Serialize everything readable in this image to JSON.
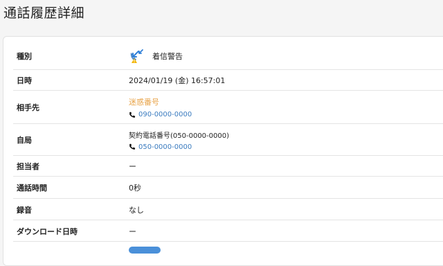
{
  "page": {
    "title": "通話履歴詳細"
  },
  "details": {
    "type_label": "種別",
    "type_value": "着信警告",
    "datetime_label": "日時",
    "datetime_value": "2024/01/19 (金) 16:57:01",
    "partner_label": "相手先",
    "partner_name": "迷惑番号",
    "partner_phone": "090-0000-0000",
    "own_label": "自局",
    "own_name": "契約電話番号(050-0000-0000)",
    "own_phone": "050-0000-0000",
    "staff_label": "担当者",
    "staff_value": "ー",
    "duration_label": "通話時間",
    "duration_value": "0秒",
    "recording_label": "録音",
    "recording_value": "なし",
    "download_label": "ダウンロード日時",
    "download_value": "ー"
  },
  "colors": {
    "accent_orange": "#e8a44a",
    "link_blue": "#3a7bbf",
    "incoming_icon_blue": "#2f80d8",
    "warning_yellow": "#f2b400"
  },
  "icons": {
    "incoming_call": "incoming-call-warning-icon",
    "phone": "phone-icon"
  }
}
